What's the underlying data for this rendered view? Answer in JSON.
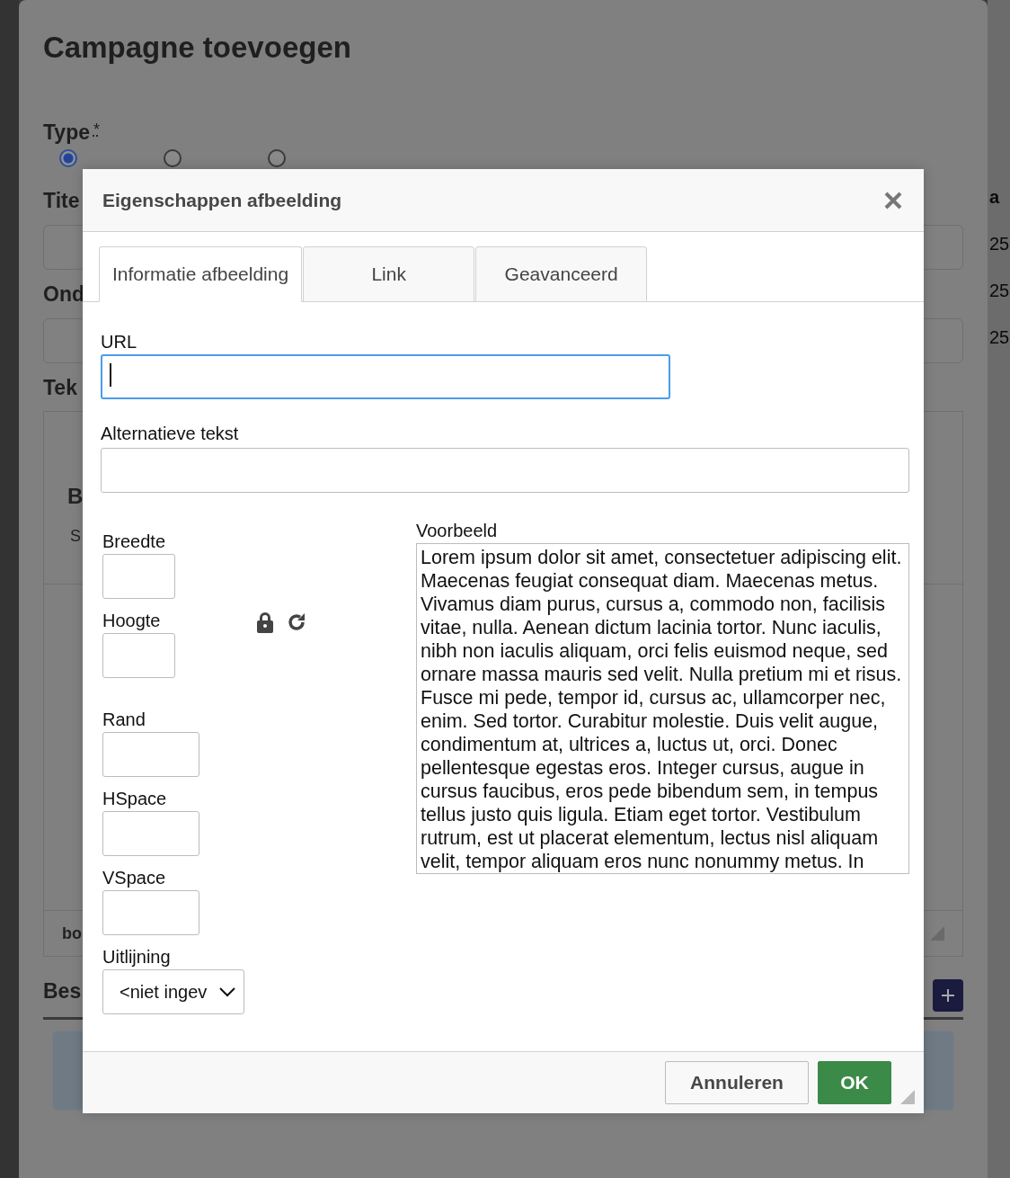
{
  "background": {
    "title": "Campagne toevoegen",
    "type_label": "Type",
    "required_mark": "*",
    "type_options": [
      {
        "selected": true
      },
      {
        "selected": false
      },
      {
        "selected": false
      }
    ],
    "title_label": "Tite",
    "subject_label": "Ond",
    "text_label": "Tek",
    "editor_heading": "B",
    "editor_line": "S",
    "editor_status": "bo",
    "section_label": "Bes",
    "side_column": [
      "a",
      "25",
      "25",
      "25"
    ]
  },
  "dialog": {
    "title": "Eigenschappen afbeelding",
    "tabs": [
      {
        "label": "Informatie afbeelding",
        "selected": true
      },
      {
        "label": "Link",
        "selected": false
      },
      {
        "label": "Geavanceerd",
        "selected": false
      }
    ],
    "url_label": "URL",
    "url_focused": true,
    "alt_label": "Alternatieve tekst",
    "size_fields": [
      {
        "label": "Breedte"
      },
      {
        "label": "Hoogte"
      }
    ],
    "spacing_fields": [
      {
        "label": "Rand"
      },
      {
        "label": "HSpace"
      },
      {
        "label": "VSpace"
      }
    ],
    "align_label": "Uitlijning",
    "align_value": "<niet ingev",
    "preview_label": "Voorbeeld",
    "preview_text": "Lorem ipsum dolor sit amet, consectetuer adipiscing elit. Maecenas feugiat consequat diam. Maecenas metus. Vivamus diam purus, cursus a, commodo non, facilisis vitae, nulla. Aenean dictum lacinia tortor. Nunc iaculis, nibh non iaculis aliquam, orci felis euismod neque, sed ornare massa mauris sed velit. Nulla pretium mi et risus. Fusce mi pede, tempor id, cursus ac, ullamcorper nec, enim. Sed tortor. Curabitur molestie. Duis velit augue, condimentum at, ultrices a, luctus ut, orci. Donec pellentesque egestas eros. Integer cursus, augue in cursus faucibus, eros pede bibendum sem, in tempus tellus justo quis ligula. Etiam eget tortor. Vestibulum rutrum, est ut placerat elementum, lectus nisl aliquam velit, tempor aliquam eros nunc nonummy metus. In",
    "buttons": [
      {
        "label": "Annuleren",
        "kind": "secondary"
      },
      {
        "label": "OK",
        "kind": "primary"
      }
    ]
  }
}
